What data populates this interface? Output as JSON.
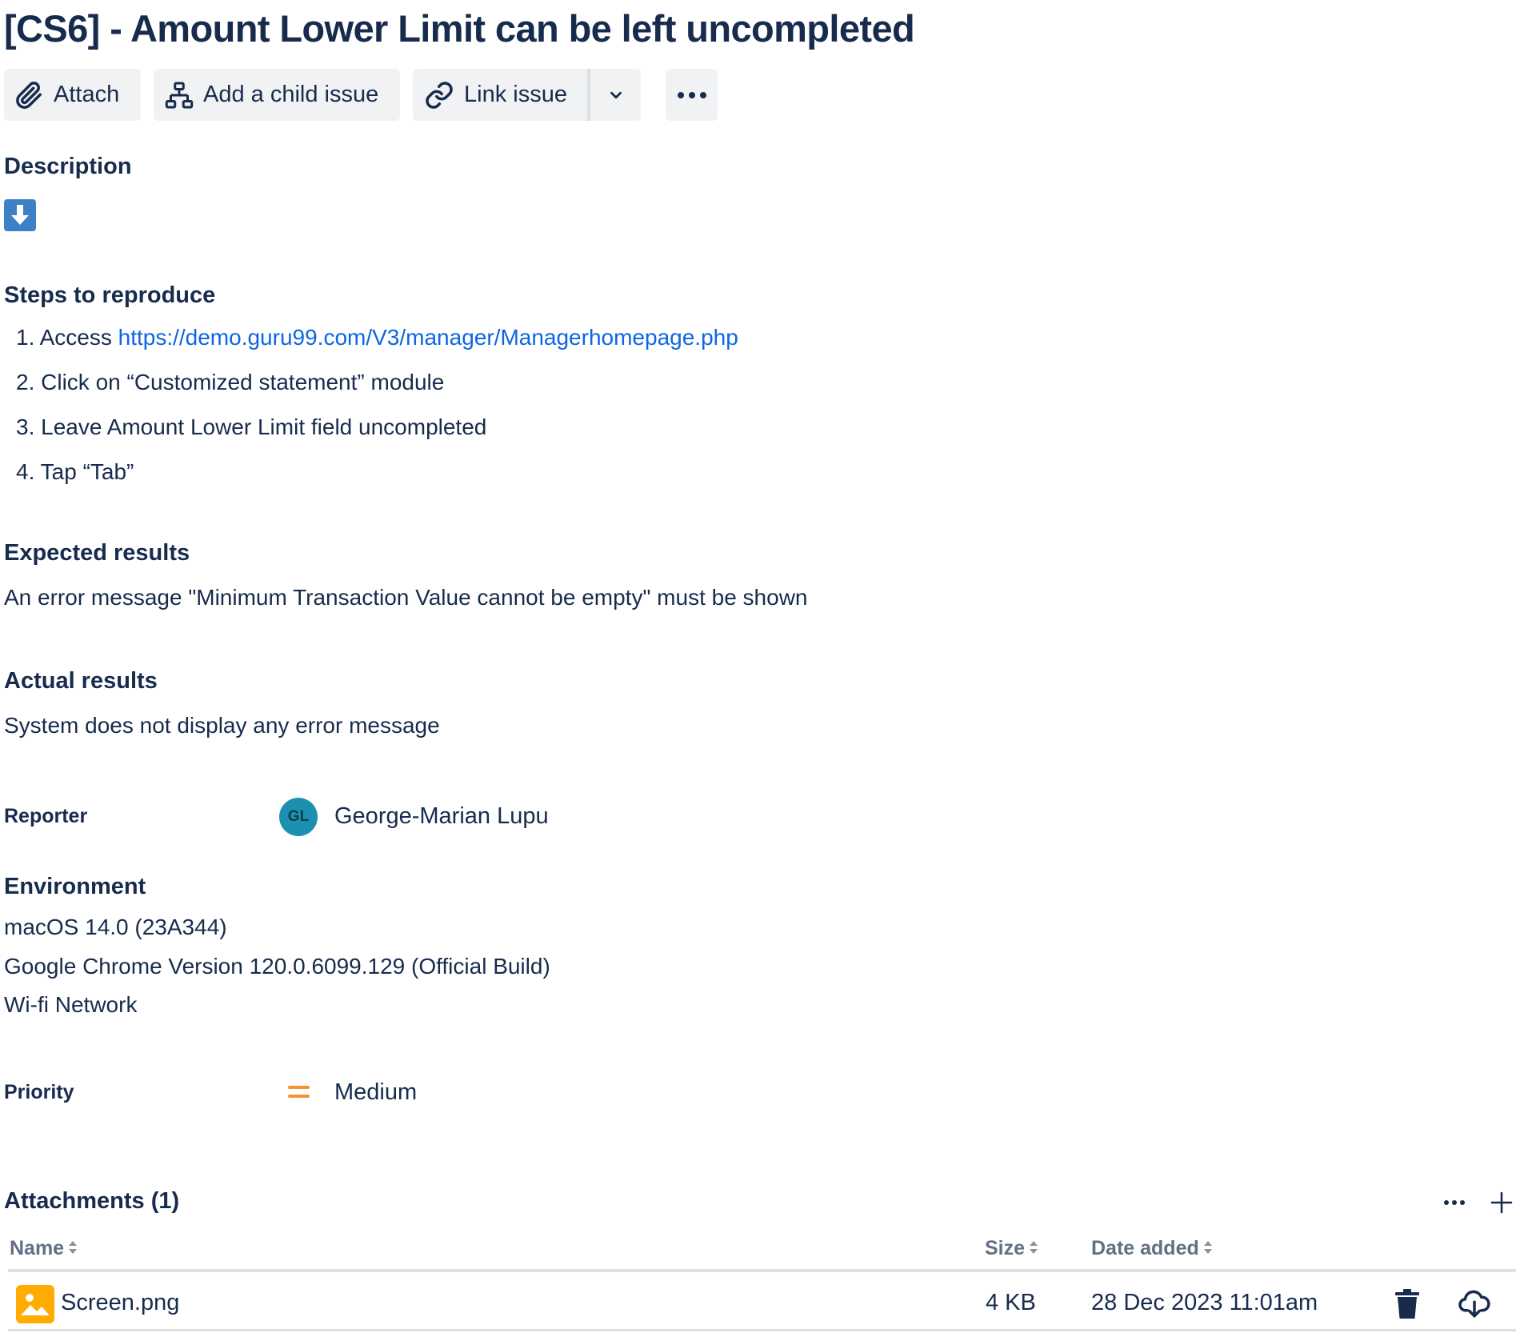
{
  "issue": {
    "title": "[CS6] - Amount Lower Limit can be left uncompleted"
  },
  "toolbar": {
    "attach_label": "Attach",
    "add_child_label": "Add a child issue",
    "link_issue_label": "Link issue"
  },
  "description": {
    "heading": "Description",
    "steps_heading": "Steps to reproduce",
    "steps": [
      {
        "num": "1.",
        "text": "Access ",
        "link": "https://demo.guru99.com/V3/manager/Managerhomepage.php"
      },
      {
        "num": "2.",
        "text": "Click on “Customized statement” module"
      },
      {
        "num": "3.",
        "text": "Leave Amount Lower Limit field uncompleted"
      },
      {
        "num": "4.",
        "text": "Tap “Tab”"
      }
    ],
    "expected_heading": "Expected results",
    "expected_text": "An error message \"Minimum Transaction Value cannot be empty\" must be shown",
    "actual_heading": "Actual results",
    "actual_text": "System does not display any error message"
  },
  "reporter": {
    "label": "Reporter",
    "initials": "GL",
    "name": "George-Marian Lupu",
    "avatar_color": "#1d8fb0"
  },
  "environment": {
    "heading": "Environment",
    "lines": [
      "macOS 14.0 (23A344)",
      "Google Chrome Version 120.0.6099.129 (Official Build)",
      "Wi-fi Network"
    ]
  },
  "priority": {
    "label": "Priority",
    "value": "Medium",
    "icon": "priority-medium-icon",
    "color": "#f79233"
  },
  "attachments": {
    "heading": "Attachments (1)",
    "columns": {
      "name": "Name",
      "size": "Size",
      "date": "Date added"
    },
    "rows": [
      {
        "name": "Screen.png",
        "size": "4 KB",
        "date": "28 Dec 2023 11:01am"
      }
    ]
  },
  "colors": {
    "text": "#172b4d",
    "link": "#0c66e4",
    "button_bg": "#f1f2f4",
    "muted": "#626f86"
  }
}
